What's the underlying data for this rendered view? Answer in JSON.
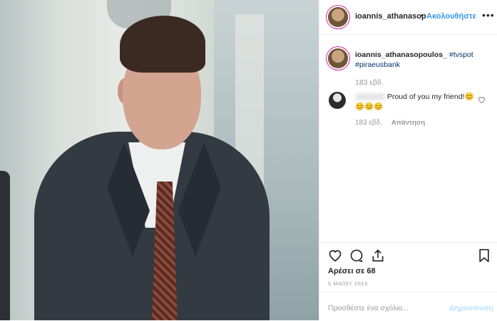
{
  "header": {
    "username": "ioannis_athanasop",
    "separator": "•",
    "follow_label": "Ακολουθήστε",
    "more_label": "•••"
  },
  "caption": {
    "username": "ioannis_athanasopoulos_",
    "hashtag1": "#tvspot",
    "hashtag2": "#piraeusbank",
    "time": "183 εβδ."
  },
  "comment": {
    "text": "Proud of you my friend!😊😊😊😊",
    "time": "183 εβδ.",
    "reply_label": "Απάντηση",
    "like_icon": "heart-outline-icon"
  },
  "actions": {
    "likes": "Αρέσει σε 68",
    "date": "5 ΜΑΪΟΥ 2016"
  },
  "add_comment": {
    "placeholder": "Προσθέστε ένα σχόλιο...",
    "post_label": "Δημοσίευση"
  },
  "colors": {
    "link": "#003569",
    "follow": "#3897f0",
    "post_disabled": "#b2dffc",
    "muted": "#999999"
  }
}
